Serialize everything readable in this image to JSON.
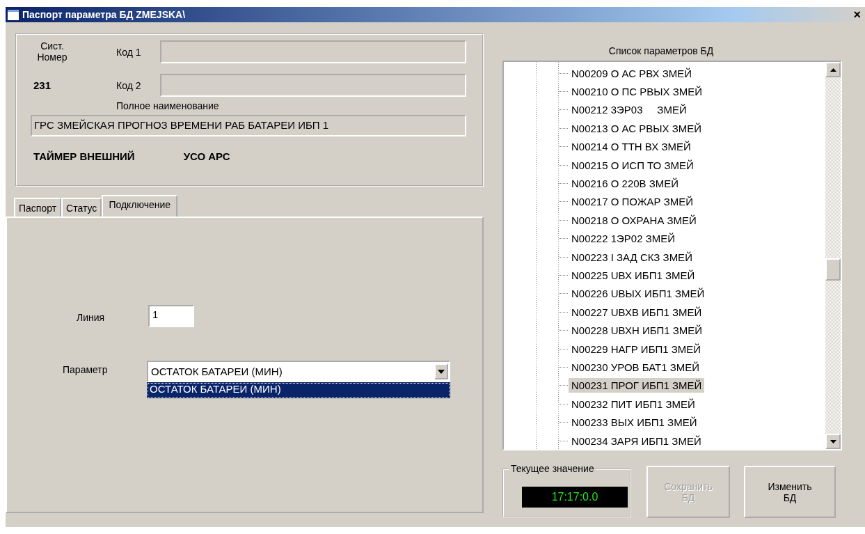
{
  "window": {
    "title": "Паспорт параметра БД ZMEJSKA\\",
    "close": "×"
  },
  "header": {
    "sys_label": "Сист. Номер",
    "sys_number": "231",
    "code1_label": "Код 1",
    "code2_label": "Код 2",
    "full_name_label": "Полное наименование",
    "full_name": "ГРС ЗМЕЙСКАЯ ПРОГНОЗ ВРЕМЕНИ РАБ БАТАРЕИ ИБП 1",
    "timer": "ТАЙМЕР ВНЕШНИЙ",
    "uso": "УСО  АРС"
  },
  "tabs": [
    {
      "label": "Паспорт",
      "selected": false
    },
    {
      "label": "Статус",
      "selected": false
    },
    {
      "label": "Подключение",
      "selected": true
    }
  ],
  "connection": {
    "line_label": "Линия",
    "line_value": "1",
    "param_label": "Параметр",
    "param_value": "ОСТАТОК БАТАРЕИ (МИН)",
    "options": [
      {
        "label": "ОСТАТОК БАТАРЕИ (МИН)",
        "selected": true
      }
    ]
  },
  "param_list": {
    "title": "Список параметров БД",
    "items": [
      {
        "label": "N00209 О АС РВХ ЗМЕЙ",
        "selected": false
      },
      {
        "label": "N00210 О ПС РВЫХ ЗМЕЙ",
        "selected": false
      },
      {
        "label": "N00212 3ЭР03     ЗМЕЙ",
        "selected": false
      },
      {
        "label": "N00213 О АС РВЫХ ЗМЕЙ",
        "selected": false
      },
      {
        "label": "N00214 О ТТН ВХ ЗМЕЙ",
        "selected": false
      },
      {
        "label": "N00215 О ИСП ТО ЗМЕЙ",
        "selected": false
      },
      {
        "label": "N00216 О 220В ЗМЕЙ",
        "selected": false
      },
      {
        "label": "N00217 О ПОЖАР ЗМЕЙ",
        "selected": false
      },
      {
        "label": "N00218 О ОХРАНА ЗМЕЙ",
        "selected": false
      },
      {
        "label": "N00222 1ЭР02 ЗМЕЙ",
        "selected": false
      },
      {
        "label": "N00223 I ЗАД СКЗ ЗМЕЙ",
        "selected": false
      },
      {
        "label": "N00225 UВХ ИБП1 ЗМЕЙ",
        "selected": false
      },
      {
        "label": "N00226 UВЫХ ИБП1 ЗМЕЙ",
        "selected": false
      },
      {
        "label": "N00227 UВХВ ИБП1 ЗМЕЙ",
        "selected": false
      },
      {
        "label": "N00228 UВХН ИБП1 ЗМЕЙ",
        "selected": false
      },
      {
        "label": "N00229 НАГР ИБП1 ЗМЕЙ",
        "selected": false
      },
      {
        "label": "N00230 УРОВ БАТ1 ЗМЕЙ",
        "selected": false
      },
      {
        "label": "N00231 ПРОГ ИБП1 ЗМЕЙ",
        "selected": true
      },
      {
        "label": "N00232 ПИТ ИБП1 ЗМЕЙ",
        "selected": false
      },
      {
        "label": "N00233 ВЫХ ИБП1 ЗМЕЙ",
        "selected": false
      },
      {
        "label": "N00234 ЗАРЯ ИБП1 ЗМЕЙ",
        "selected": false
      }
    ]
  },
  "current_value": {
    "label": "Текущее значение",
    "value": "17:17:0.0"
  },
  "buttons": [
    {
      "label": "Сохранить БД",
      "disabled": true
    },
    {
      "label": "Изменить БД",
      "disabled": false
    }
  ]
}
